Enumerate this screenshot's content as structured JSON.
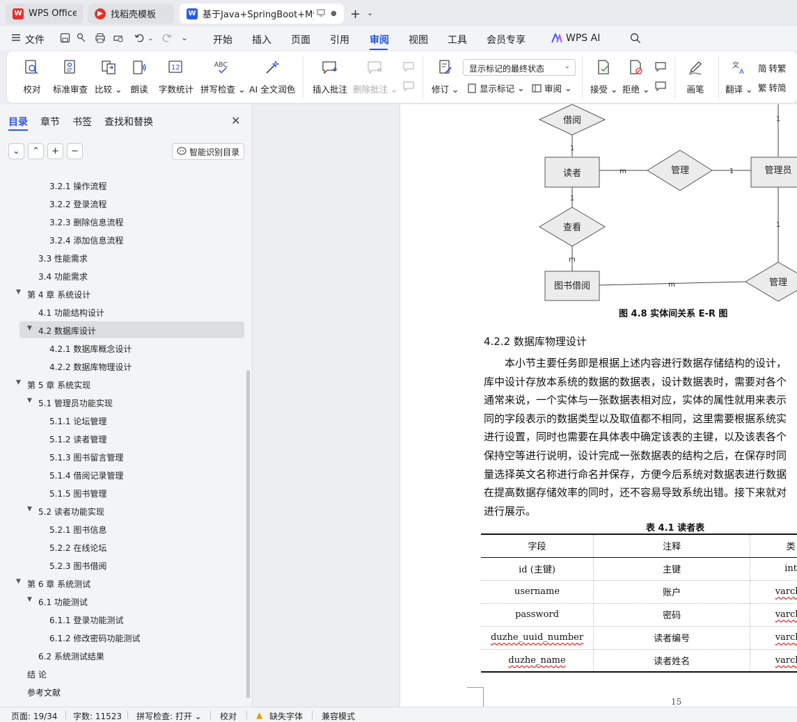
{
  "tabs": [
    {
      "label": "WPS Office",
      "icon": "wps-logo-icon"
    },
    {
      "label": "找稻壳模板",
      "icon": "docer-icon"
    },
    {
      "label": "基于Java+SpringBoot+MyS",
      "icon": "word-doc-icon"
    }
  ],
  "menu": {
    "file": "文件",
    "items": [
      "开始",
      "插入",
      "页面",
      "引用",
      "审阅",
      "视图",
      "工具",
      "会员专享"
    ],
    "active": "审阅",
    "wps_ai": "WPS AI"
  },
  "ribbon": {
    "proofread": "校对",
    "standard_review": "标准审查",
    "compare": "比较",
    "read_aloud": "朗读",
    "word_count": "字数统计",
    "spell_check": "拼写检查",
    "ai_polish": "AI 全文润色",
    "insert_comment": "插入批注",
    "delete_comment": "删除批注",
    "revise": "修订",
    "markup_select": "显示标记的最终状态",
    "show_markup": "显示标记",
    "review": "审阅",
    "accept": "接受",
    "reject": "拒绝",
    "pen": "画笔",
    "translate": "翻译",
    "to_traditional": "转繁",
    "to_simplified": "转简"
  },
  "nav": {
    "tabs": [
      "目录",
      "章节",
      "书签",
      "查找和替换"
    ],
    "ai_button": "智能识别目录",
    "toc": [
      {
        "text": "3.2.1  操作流程",
        "level": 3
      },
      {
        "text": "3.2.2  登录流程",
        "level": 3
      },
      {
        "text": "3.2.3  删除信息流程",
        "level": 3
      },
      {
        "text": "3.2.4  添加信息流程",
        "level": 3
      },
      {
        "text": "3.3  性能需求",
        "level": 2
      },
      {
        "text": "3.4  功能需求",
        "level": 2
      },
      {
        "text": "第 4 章  系统设计",
        "level": 1,
        "expanded": true
      },
      {
        "text": "4.1  功能结构设计",
        "level": 2
      },
      {
        "text": "4.2  数据库设计",
        "level": 2,
        "expanded": true,
        "selected": true
      },
      {
        "text": "4.2.1  数据库概念设计",
        "level": 3
      },
      {
        "text": "4.2.2  数据库物理设计",
        "level": 3
      },
      {
        "text": "第 5 章  系统实现",
        "level": 1,
        "expanded": true
      },
      {
        "text": "5.1  管理员功能实现",
        "level": 2,
        "expanded": true
      },
      {
        "text": "5.1.1  论坛管理",
        "level": 3
      },
      {
        "text": "5.1.2  读者管理",
        "level": 3
      },
      {
        "text": "5.1.3  图书留言管理",
        "level": 3
      },
      {
        "text": "5.1.4  借阅记录管理",
        "level": 3
      },
      {
        "text": "5.1.5  图书管理",
        "level": 3
      },
      {
        "text": "5.2  读者功能实现",
        "level": 2,
        "expanded": true
      },
      {
        "text": "5.2.1  图书信息",
        "level": 3
      },
      {
        "text": "5.2.2  在线论坛",
        "level": 3
      },
      {
        "text": "5.2.3  图书借阅",
        "level": 3
      },
      {
        "text": "第 6 章  系统测试",
        "level": 1,
        "expanded": true
      },
      {
        "text": "6.1  功能测试",
        "level": 2,
        "expanded": true
      },
      {
        "text": "6.1.1  登录功能测试",
        "level": 3
      },
      {
        "text": "6.1.2  修改密码功能测试",
        "level": 3
      },
      {
        "text": "6.2  系统测试结果",
        "level": 2
      },
      {
        "text": "结    论",
        "level": 1
      },
      {
        "text": "参考文献",
        "level": 1
      }
    ]
  },
  "doc": {
    "er": {
      "borrow": "借阅",
      "reader": "读者",
      "manage1": "管理",
      "admin": "管理员",
      "view": "查看",
      "book_borrow": "图书借阅",
      "manage2": "管理",
      "card_1a": "1",
      "card_1b": "1",
      "card_m1": "m",
      "card_1c": "1",
      "card_1d": "1",
      "card_m2": "m",
      "card_1e": "1",
      "card_m3": "m"
    },
    "figure_caption": "图 4.8  实体间关系 E-R 图",
    "section_heading": "4.2.2  数据库物理设计",
    "paragraph_lines": [
      "本小节主要任务即是根据上述内容进行数据存储结构的设计，",
      "库中设计存放本系统的数据的数据表，设计数据表时，需要对各个",
      "通常来说，一个实体与一张数据表相对应，实体的属性就用来表示",
      "同的字段表示的数据类型以及取值都不相同，这里需要根据系统实",
      "进行设置，同时也需要在具体表中确定该表的主键，以及该表各个",
      "保持空等进行说明，设计完成一张数据表的结构之后，在保存时同",
      "量选择英文名称进行命名并保存，方便今后系统对数据表进行数据",
      "在提高数据存储效率的同时，还不容易导致系统出错。接下来就对",
      "进行展示。"
    ],
    "table_caption": "表 4.1  读者表",
    "table_header": [
      "字段",
      "注释",
      "类"
    ],
    "table_rows": [
      [
        "id (主键)",
        "主键",
        "int"
      ],
      [
        "username",
        "账户",
        "varcha"
      ],
      [
        "password",
        "密码",
        "varcha"
      ],
      [
        "duzhe_uuid_number",
        "读者编号",
        "varcha"
      ],
      [
        "duzhe_name",
        "读者姓名",
        "varcha"
      ]
    ],
    "page_number": "15"
  },
  "status": {
    "page": "页面: 19/34",
    "words": "字数: 11523",
    "spell": "拼写检查: 打开",
    "proof": "校对",
    "missing_font": "缺失字体",
    "compat": "兼容模式"
  },
  "colors": {
    "accent": "#2a55e5",
    "wps_red": "#e5322d",
    "word_blue": "#2a5ce6"
  }
}
